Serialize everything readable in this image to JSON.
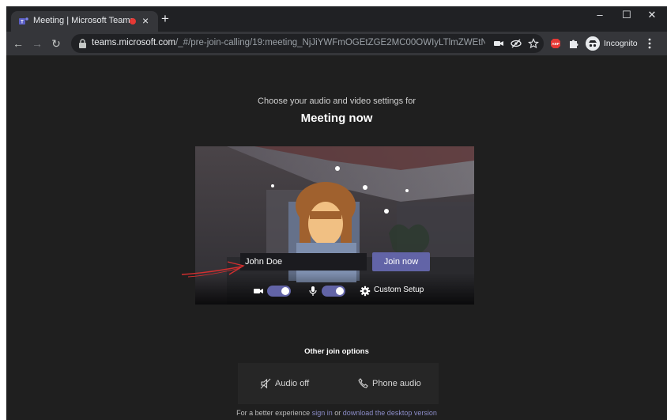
{
  "browser": {
    "tab_title": "Meeting | Microsoft Teams",
    "tab_close": "×",
    "new_tab": "+",
    "url_host": "teams.microsoft.com",
    "url_path": "/_#/pre-join-calling/19:meeting_NjJiYWFmOGEtZGE2MC00OWIyLTlmZWEtNDA2MTA2...",
    "profile_label": "Incognito",
    "window_controls": {
      "minimize": "–",
      "maximize": "☐",
      "close": "✕"
    }
  },
  "page": {
    "subtitle": "Choose your audio and video settings for",
    "title": "Meeting now",
    "name_input_value": "John Doe",
    "join_button": "Join now",
    "custom_setup": "Custom Setup",
    "camera_toggle_on": true,
    "mic_toggle_on": true,
    "other_options_title": "Other join options",
    "audio_off": "Audio off",
    "phone_audio": "Phone audio",
    "footer_prefix": "For a better experience",
    "footer_link1": "sign in",
    "footer_mid": "or",
    "footer_link2": "download the desktop version"
  },
  "colors": {
    "accent": "#6264a7",
    "page_bg": "#1f1f1f",
    "annotation": "#d32f2f"
  }
}
